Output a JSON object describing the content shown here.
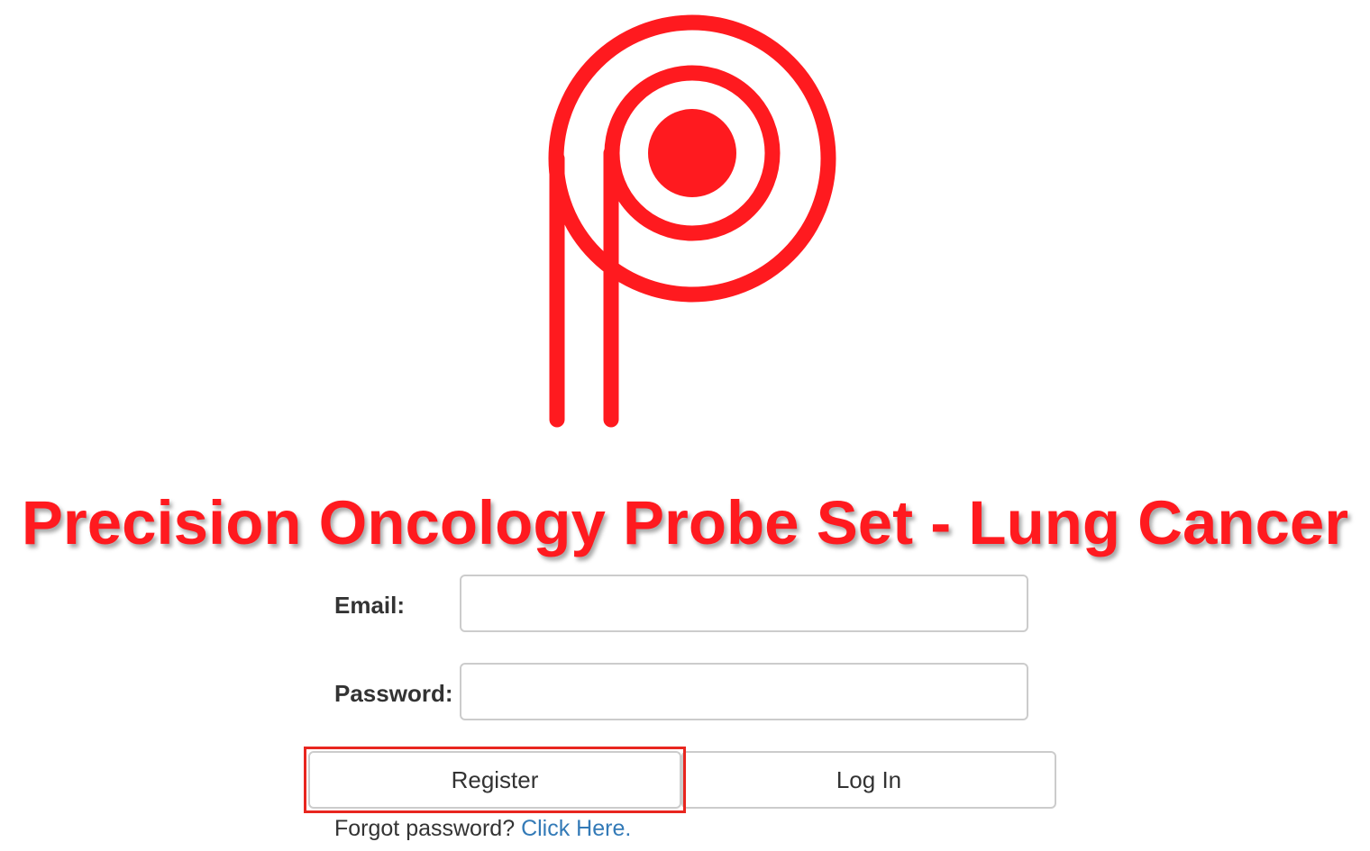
{
  "app": {
    "title": "Precision Oncology Probe Set - Lung Cancer",
    "accent_color": "#ff1a1f",
    "link_color": "#337ab7"
  },
  "logo": {
    "icon": "precision-oncology-p-logo-icon"
  },
  "form": {
    "email_label": "Email:",
    "email_value": "",
    "email_placeholder": "",
    "password_label": "Password:",
    "password_value": "",
    "password_placeholder": "",
    "register_label": "Register",
    "login_label": "Log In",
    "forgot_text": "Forgot password?",
    "forgot_link": "Click Here."
  }
}
